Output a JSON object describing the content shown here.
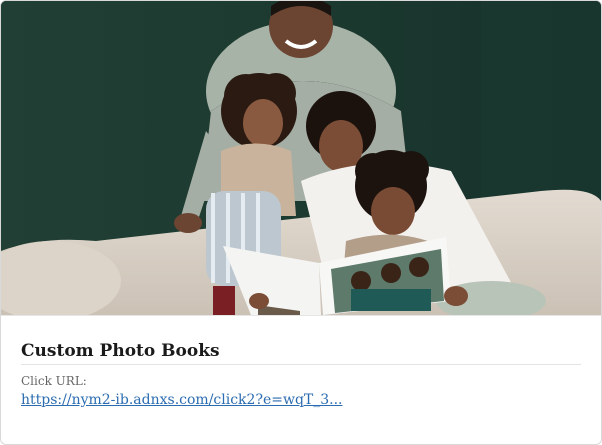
{
  "ad": {
    "title": "Custom Photo Books",
    "click_label": "Click URL:",
    "click_url": "https://nym2-ib.adnxs.com/click2?e=wqT_3..."
  },
  "colors": {
    "wall": "#1f3b32",
    "sofa": "#d8cfc4",
    "link": "#2b6cb0"
  },
  "image": {
    "alt": "family-reading-photo-book"
  }
}
